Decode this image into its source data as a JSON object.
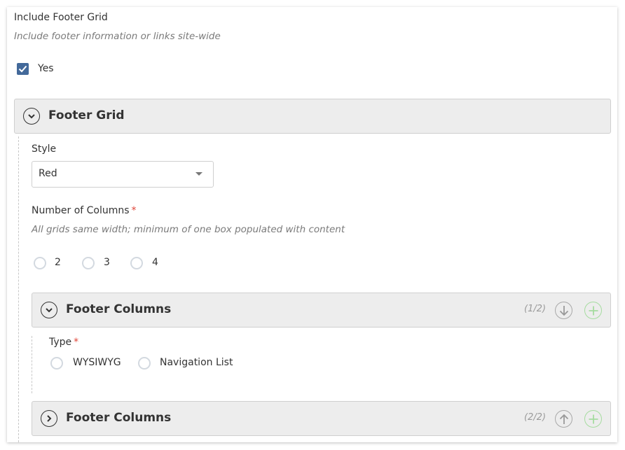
{
  "include_footer": {
    "label": "Include Footer Grid",
    "help": "Include footer information or links site-wide",
    "checkbox_label": "Yes",
    "checked": true
  },
  "footer_grid": {
    "title": "Footer Grid",
    "expanded": true,
    "style": {
      "label": "Style",
      "value": "Red"
    },
    "columns": {
      "label": "Number of Columns",
      "required_mark": "*",
      "help": "All grids same width; minimum of one box populated with content",
      "options": [
        "2",
        "3",
        "4"
      ]
    }
  },
  "footer_columns": [
    {
      "title": "Footer Columns",
      "counter": "(1/2)",
      "expanded": true,
      "move_icon": "arrow-down-icon",
      "type": {
        "label": "Type",
        "required_mark": "*",
        "options": [
          "WYSIWYG",
          "Navigation List"
        ]
      }
    },
    {
      "title": "Footer Columns",
      "counter": "(2/2)",
      "expanded": false,
      "move_icon": "arrow-up-icon"
    }
  ],
  "colors": {
    "checkbox": "#43699a",
    "required": "#e0473b",
    "add_button": "#a6dca0",
    "panel_bg": "#ededed"
  }
}
